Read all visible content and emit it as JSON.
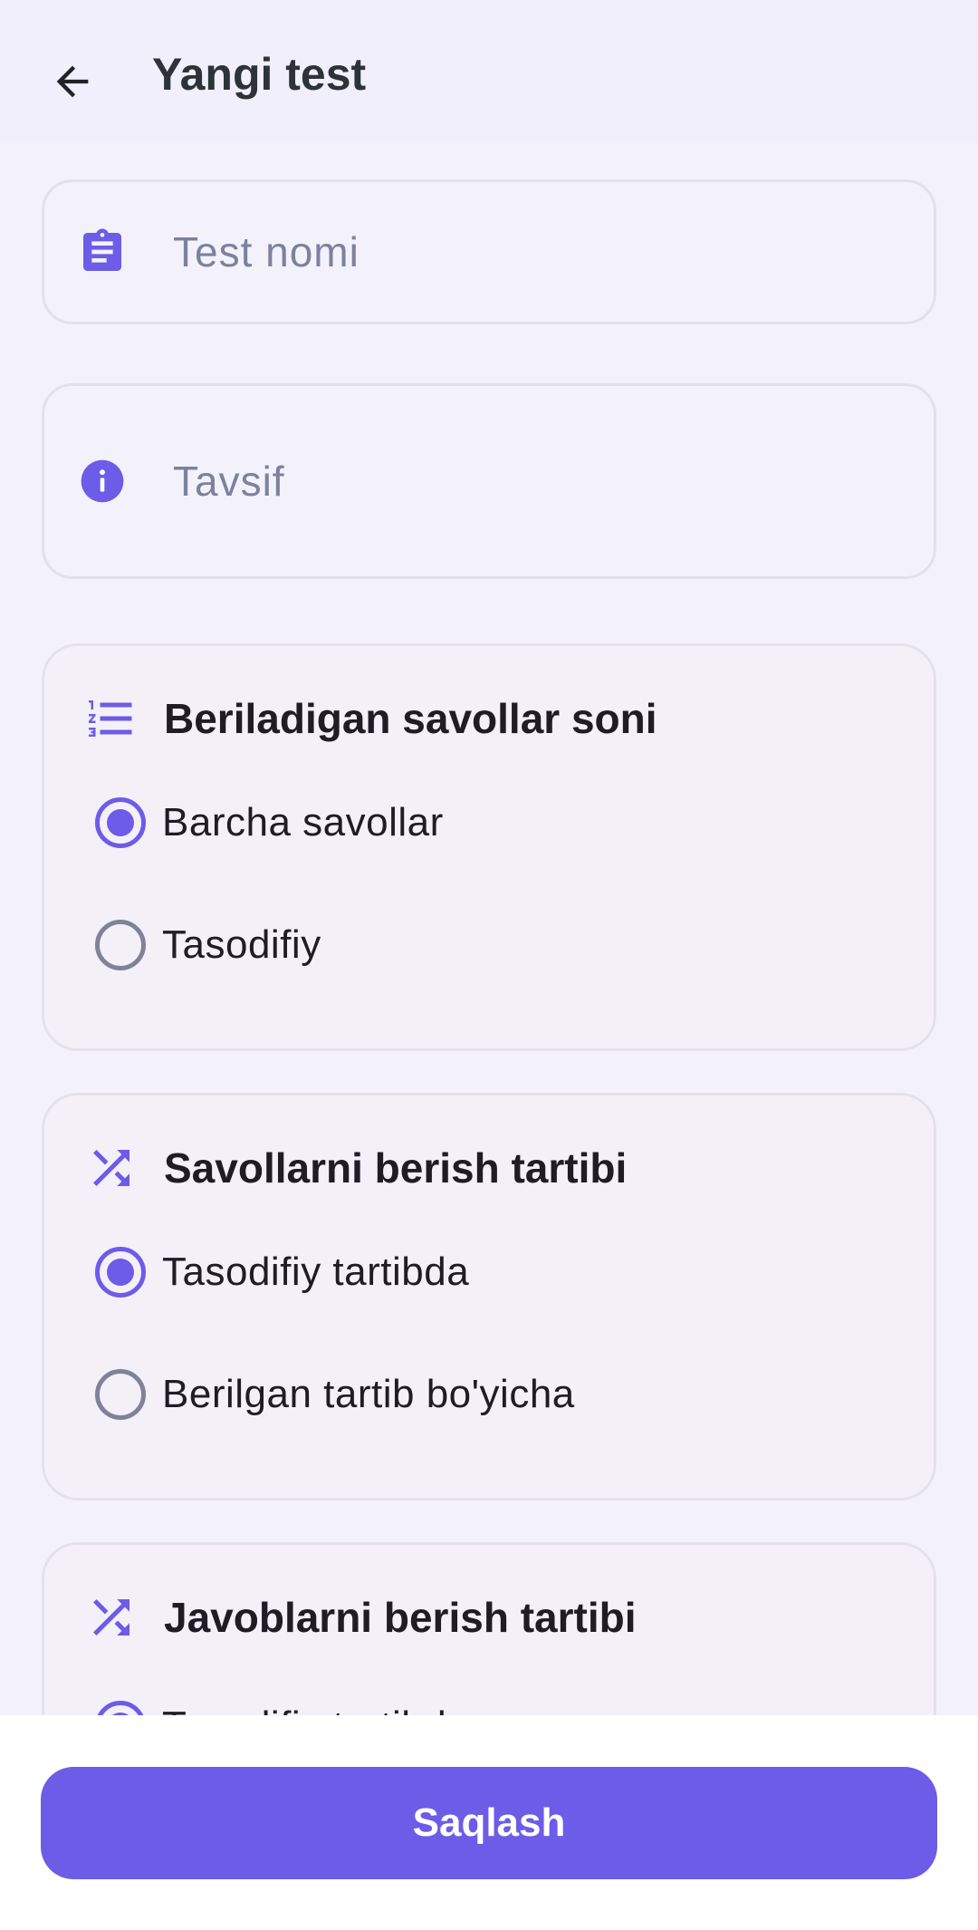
{
  "header": {
    "title": "Yangi test",
    "back_icon": "arrow-left-icon"
  },
  "form": {
    "name_placeholder": "Test nomi",
    "name_icon": "clipboard-icon",
    "description_placeholder": "Tavsif",
    "description_icon": "info-icon"
  },
  "sections": [
    {
      "title": "Beriladigan savollar soni",
      "icon": "numbered-list-icon",
      "options": [
        {
          "label": "Barcha savollar",
          "selected": true
        },
        {
          "label": "Tasodifiy",
          "selected": false
        }
      ]
    },
    {
      "title": "Savollarni berish tartibi",
      "icon": "shuffle-icon",
      "options": [
        {
          "label": "Tasodifiy tartibda",
          "selected": true
        },
        {
          "label": "Berilgan tartib bo'yicha",
          "selected": false
        }
      ]
    },
    {
      "title": "Javoblarni berish tartibi",
      "icon": "shuffle-icon",
      "options": [
        {
          "label": "Tasodifiy tartibda",
          "selected": true
        }
      ]
    }
  ],
  "footer": {
    "save_label": "Saqlash"
  },
  "colors": {
    "accent": "#6C5CE7",
    "background": "#F3F2FA",
    "card": "#F4F0F7",
    "placeholder": "#7C819E"
  }
}
